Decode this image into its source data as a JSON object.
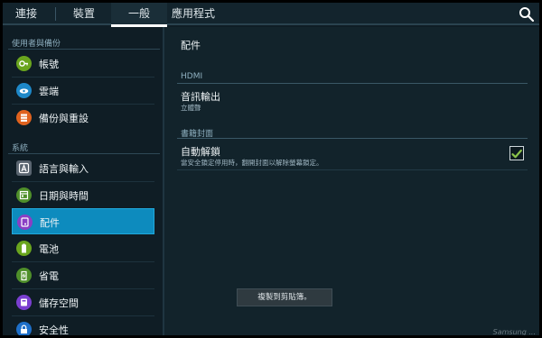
{
  "tabs": [
    {
      "label": "連接"
    },
    {
      "label": "裝置"
    },
    {
      "label": "一般"
    },
    {
      "label": "應用程式"
    }
  ],
  "sidebar": {
    "sections": [
      {
        "title": "使用者與備份"
      },
      {
        "title": "系統"
      }
    ],
    "items": [
      {
        "label": "帳號",
        "icon": "key-icon",
        "color": "#6aa51e"
      },
      {
        "label": "雲端",
        "icon": "cloud-icon",
        "color": "#1e88c8"
      },
      {
        "label": "備份與重設",
        "icon": "backup-icon",
        "color": "#e0621e"
      },
      {
        "label": "語言與輸入",
        "icon": "language-icon",
        "color": "#5a6570"
      },
      {
        "label": "日期與時間",
        "icon": "calendar-icon",
        "color": "#4f8f2a"
      },
      {
        "label": "配件",
        "icon": "accessory-icon",
        "color": "#8a3fc4"
      },
      {
        "label": "電池",
        "icon": "battery-icon",
        "color": "#6aa51e"
      },
      {
        "label": "省電",
        "icon": "power-saving-icon",
        "color": "#4f8f2a"
      },
      {
        "label": "儲存空間",
        "icon": "storage-icon",
        "color": "#7a3fd0"
      },
      {
        "label": "安全性",
        "icon": "lock-icon",
        "color": "#1e6fc8"
      }
    ]
  },
  "main": {
    "title": "配件",
    "hdmi": {
      "section_title": "HDMI",
      "row_title": "音訊輸出",
      "row_sub": "立體聲"
    },
    "cover": {
      "section_title": "書籍封面",
      "row_title": "自動解鎖",
      "row_sub": "當安全鎖定停用時，翻開封面以解除螢幕鎖定。",
      "checked": true
    },
    "toast": "複製到剪貼簿。"
  },
  "watermark": "Samsung ...",
  "colors": {
    "accent": "#0d8bbe",
    "check": "#8bc34a"
  }
}
